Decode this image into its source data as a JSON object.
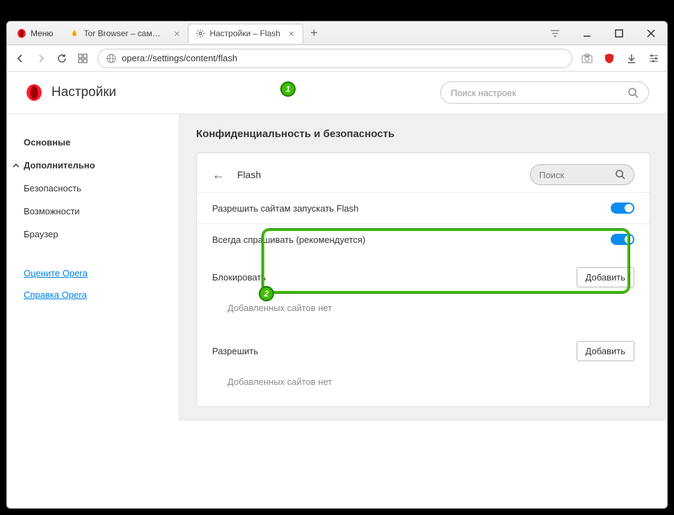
{
  "titlebar": {
    "menu_label": "Меню",
    "tabs": [
      {
        "title": "Tor Browser – самый защи",
        "active": false
      },
      {
        "title": "Настройки – Flash",
        "active": true
      }
    ]
  },
  "addressbar": {
    "url": "opera://settings/content/flash"
  },
  "page": {
    "title": "Настройки",
    "search_placeholder": "Поиск настроек"
  },
  "sidebar": {
    "basic": "Основные",
    "advanced": "Дополнительно",
    "sub": {
      "security": "Безопасность",
      "features": "Возможности",
      "browser": "Браузер"
    },
    "rate_link": "Оцените Opera",
    "help_link": "Справка Opera"
  },
  "main": {
    "section_title": "Конфиденциальность и безопасность",
    "panel_title": "Flash",
    "panel_search_placeholder": "Поиск",
    "row1_label": "Разрешить сайтам запускать Flash",
    "row2_label": "Всегда спрашивать (рекомендуется)",
    "block": {
      "title": "Блокировать",
      "add": "Добавить",
      "empty": "Добавленных сайтов нет"
    },
    "allow": {
      "title": "Разрешить",
      "add": "Добавить",
      "empty": "Добавленных сайтов нет"
    }
  },
  "annotations": {
    "badge1": "1",
    "badge2": "2"
  }
}
